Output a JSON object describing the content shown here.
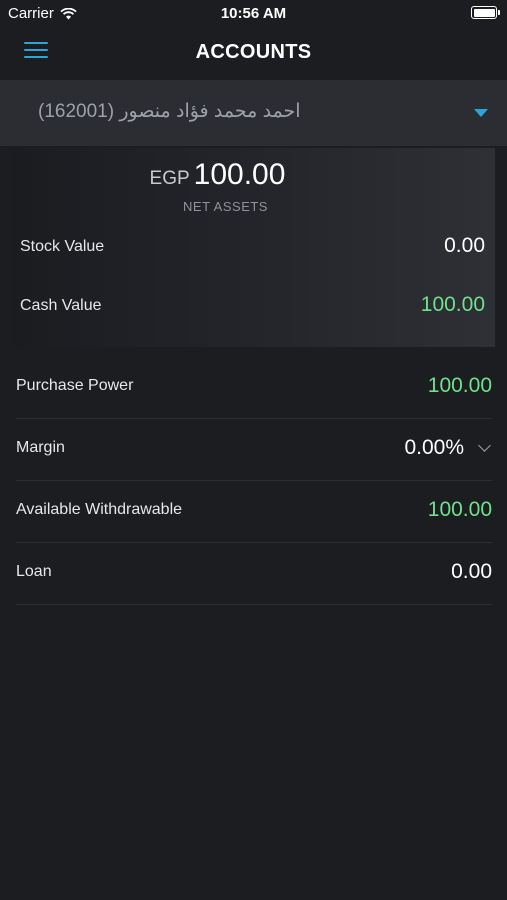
{
  "status_bar": {
    "carrier": "Carrier",
    "time": "10:56 AM"
  },
  "nav": {
    "title": "ACCOUNTS",
    "menu_icon": "hamburger-menu-icon"
  },
  "account": {
    "name": "احمد محمد فؤاد منصور (162001)"
  },
  "summary": {
    "currency": "EGP",
    "net_assets_value": "100.00",
    "net_assets_label": "NET ASSETS",
    "stock_value_label": "Stock Value",
    "stock_value": "0.00",
    "cash_value_label": "Cash Value",
    "cash_value": "100.00"
  },
  "details": {
    "purchase_power_label": "Purchase Power",
    "purchase_power": "100.00",
    "margin_label": "Margin",
    "margin": "0.00%",
    "available_withdrawable_label": "Available Withdrawable",
    "available_withdrawable": "100.00",
    "loan_label": "Loan",
    "loan": "0.00"
  },
  "colors": {
    "accent": "#2aa7d8",
    "positive": "#6ee28a",
    "background": "#1c1d21",
    "selector_bg": "#2b2d33"
  }
}
